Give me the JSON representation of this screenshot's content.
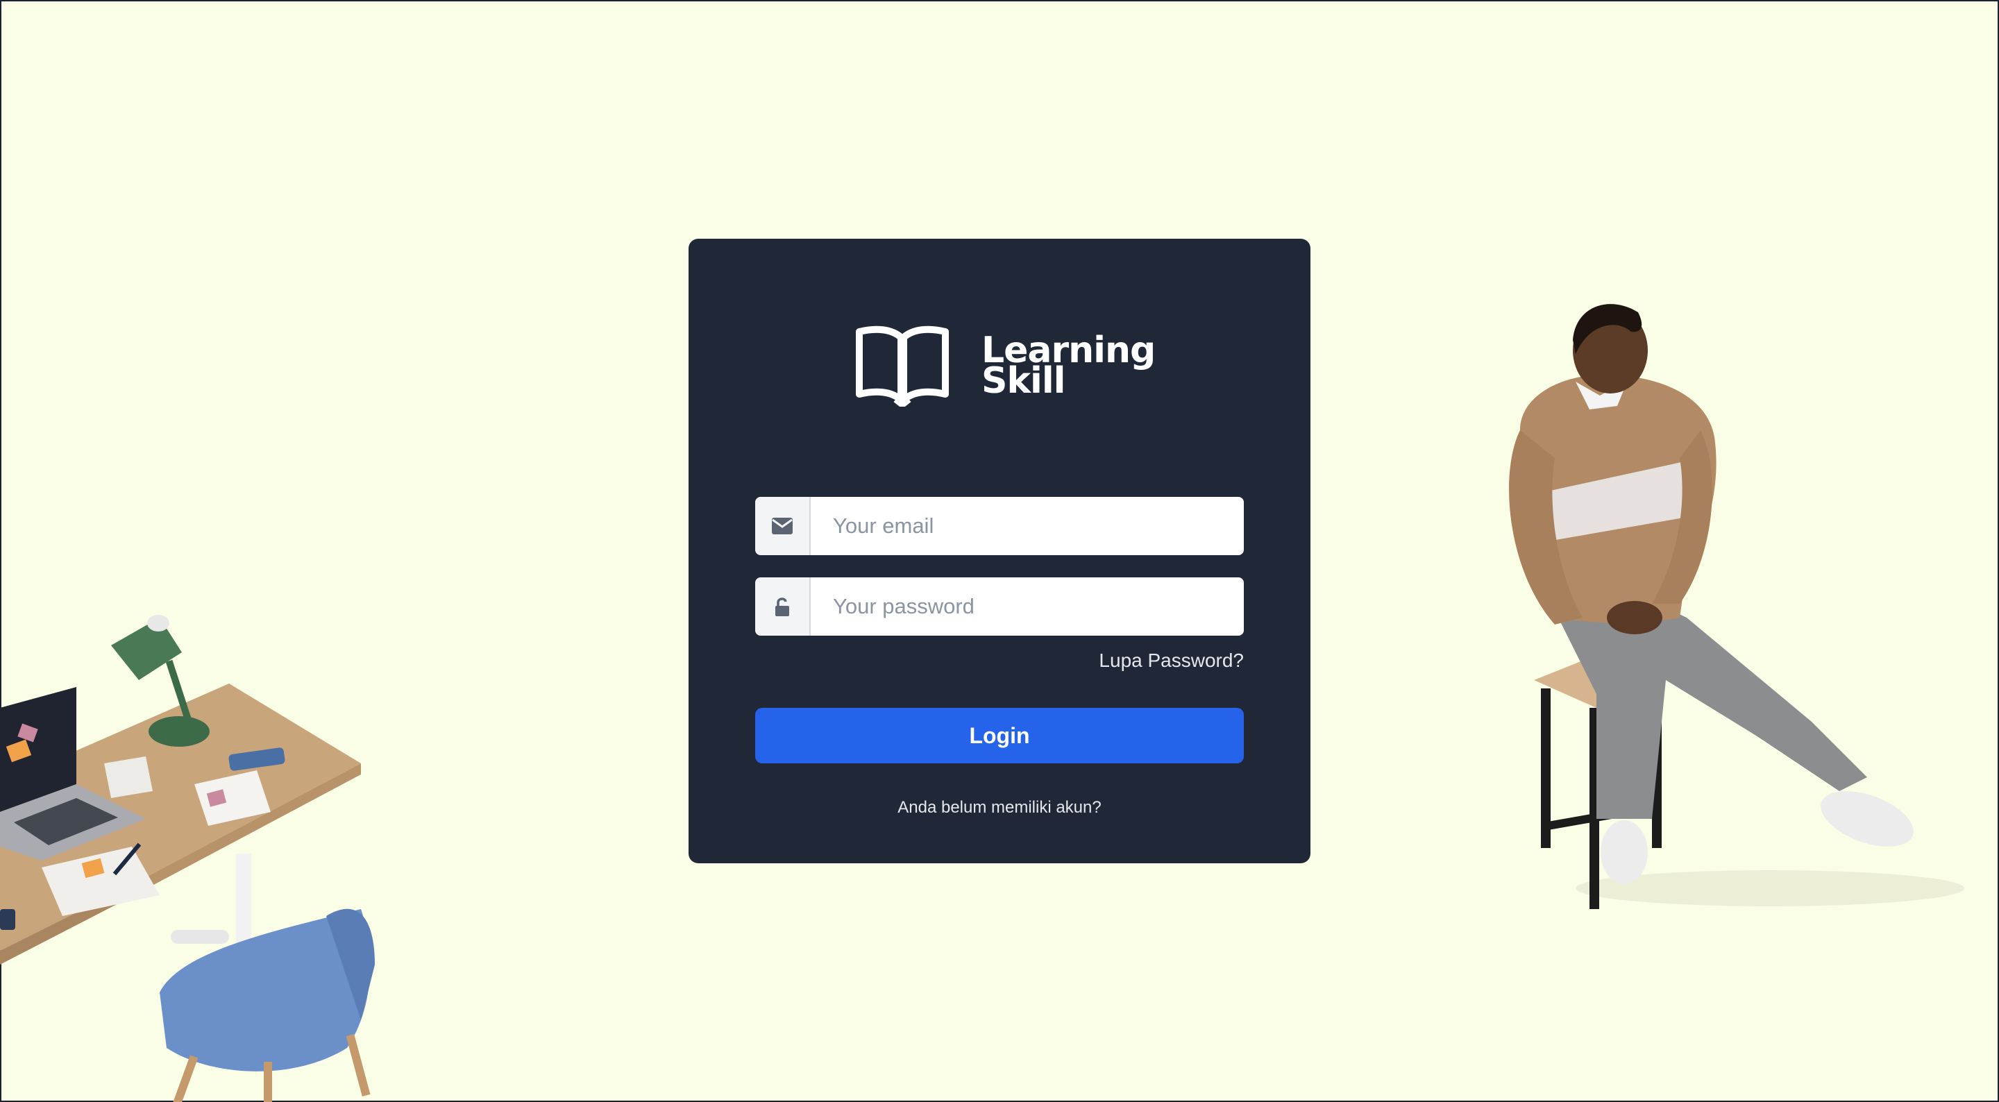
{
  "brand": {
    "line1": "Learning",
    "line2": "Skill"
  },
  "form": {
    "email_placeholder": "Your email",
    "password_placeholder": "Your password",
    "forgot_label": "Lupa Password?",
    "login_label": "Login",
    "register_label": "Anda belum memiliki akun?"
  },
  "colors": {
    "background": "#fbfee6",
    "card": "#202837",
    "accent": "#2563eb"
  },
  "icons": {
    "email": "envelope-icon",
    "password": "unlock-icon",
    "logo": "open-book-icon"
  }
}
